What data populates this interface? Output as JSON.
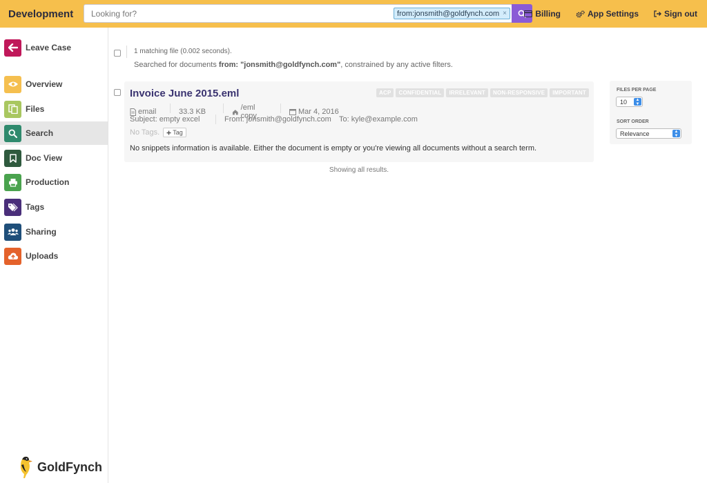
{
  "app": {
    "title": "Development"
  },
  "search": {
    "placeholder": "Looking for?",
    "value": "",
    "token": "from:jonsmith@goldfynch.com",
    "token_close": "×"
  },
  "top_nav": {
    "billing": "Billing",
    "app_settings": "App Settings",
    "sign_out": "Sign out"
  },
  "sidebar": {
    "items": [
      {
        "label": "Leave Case",
        "icon": "arrow-left-icon",
        "color": "#c0185a"
      },
      {
        "label": "Overview",
        "icon": "eye-icon",
        "color": "#f5bf4f"
      },
      {
        "label": "Files",
        "icon": "files-icon",
        "color": "#a9c760"
      },
      {
        "label": "Search",
        "icon": "search-icon",
        "color": "#2f8a6d"
      },
      {
        "label": "Doc View",
        "icon": "bookmark-icon",
        "color": "#2f5a3e"
      },
      {
        "label": "Production",
        "icon": "print-icon",
        "color": "#4aa34e"
      },
      {
        "label": "Tags",
        "icon": "tags-icon",
        "color": "#4a2f7a"
      },
      {
        "label": "Sharing",
        "icon": "users-icon",
        "color": "#1f4f7a"
      },
      {
        "label": "Uploads",
        "icon": "cloud-upload-icon",
        "color": "#e4622b"
      }
    ],
    "active_index": 3,
    "logo_text": "GoldFynch"
  },
  "results": {
    "summary": "1 matching file (0.002 seconds).",
    "searched_prefix": "Searched for documents ",
    "searched_query": "from: \"jonsmith@goldfynch.com\"",
    "searched_suffix": ", constrained by any active filters.",
    "showing": "Showing all results.",
    "items": [
      {
        "title": "Invoice June 2015.eml",
        "labels": [
          "ACP",
          "CONFIDENTIAL",
          "IRRELEVANT",
          "NON-RESPONSIVE",
          "IMPORTANT"
        ],
        "type": "email",
        "size": "33.3 KB",
        "path": "/eml copy",
        "date": "Mar 4, 2016",
        "subject": "Subject: empty excel",
        "from": "From: jonsmith@goldfynch.com",
        "to": "To: kyle@example.com",
        "no_tags": "No Tags.",
        "tag_button": "Tag",
        "snippet": "No snippets information is available. Either the document is empty or you're viewing all documents without a search term."
      }
    ]
  },
  "panel": {
    "files_per_page_label": "FILES PER PAGE",
    "files_per_page_value": "10",
    "sort_order_label": "SORT ORDER",
    "sort_order_value": "Relevance"
  },
  "colors": {
    "topbar": "#f6bf4c",
    "search_button": "#8b5bd6",
    "title": "#3a3370"
  }
}
